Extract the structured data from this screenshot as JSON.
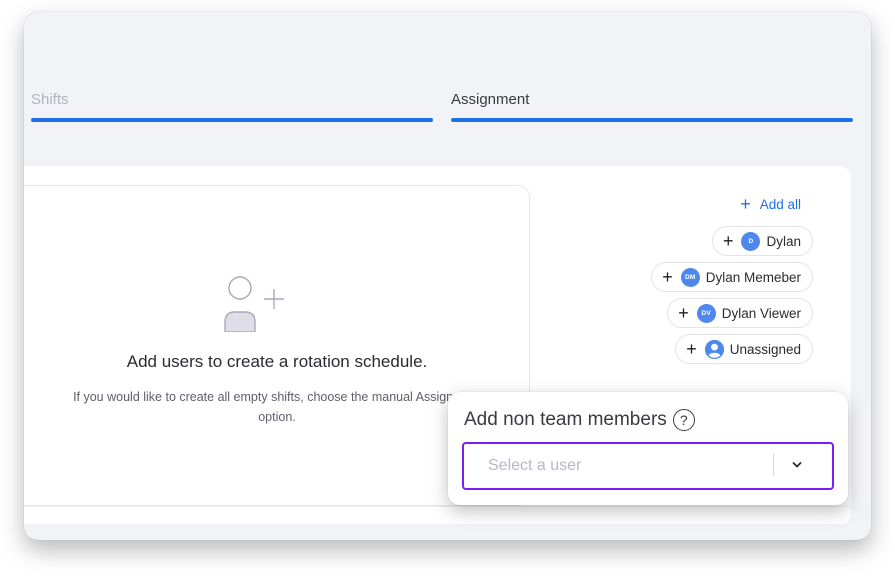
{
  "tabs": [
    {
      "label": "Shifts",
      "active": false
    },
    {
      "label": "Assignment",
      "active": true
    }
  ],
  "empty_state": {
    "icon": "add-user-icon",
    "title": "Add users to create a rotation schedule.",
    "description": "If you would like to create all empty shifts, choose the manual Assignment option."
  },
  "users_panel": {
    "add_all_label": "Add all",
    "users": [
      {
        "name": "Dylan",
        "initials": "D",
        "avatar": "initials"
      },
      {
        "name": "Dylan Memeber",
        "initials": "DM",
        "avatar": "initials"
      },
      {
        "name": "Dylan Viewer",
        "initials": "DV",
        "avatar": "initials"
      },
      {
        "name": "Unassigned",
        "initials": "",
        "avatar": "person-icon"
      }
    ],
    "avatar_color": "#4e88ee"
  },
  "non_team_popover": {
    "title": "Add non team members",
    "help_icon": "?",
    "select": {
      "placeholder": "Select a user",
      "value": ""
    }
  },
  "colors": {
    "accent_blue": "#1f6fec",
    "focus_purple": "#7a1ff0"
  }
}
